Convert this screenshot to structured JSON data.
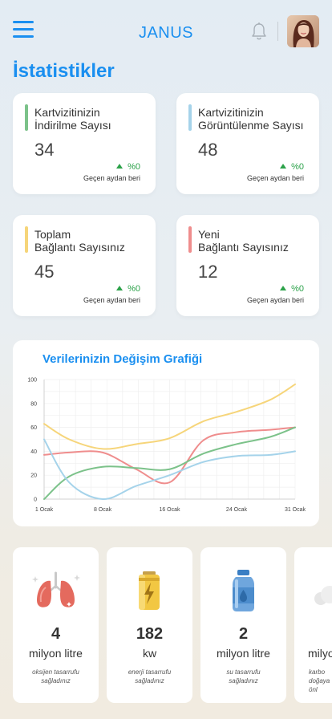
{
  "header": {
    "app_title": "JANUS",
    "menu_icon": "hamburger-menu-icon",
    "notification_icon": "bell-icon",
    "avatar": "user-avatar"
  },
  "page_title": "İstatistikler",
  "stats": [
    {
      "label": "Kartvizitinizin\nİndirilme Sayısı",
      "value": "34",
      "change": "%0",
      "since": "Geçen aydan beri",
      "accent": "#7cc28a"
    },
    {
      "label": "Kartvizitinizin\nGörüntülenme Sayısı",
      "value": "48",
      "change": "%0",
      "since": "Geçen aydan beri",
      "accent": "#a5d3ea"
    },
    {
      "label": "Toplam\nBağlantı Sayısınız",
      "value": "45",
      "change": "%0",
      "since": "Geçen aydan beri",
      "accent": "#f6d57a"
    },
    {
      "label": "Yeni\nBağlantı Sayısınız",
      "value": "12",
      "change": "%0",
      "since": "Geçen aydan beri",
      "accent": "#ef8d8d"
    }
  ],
  "chart": {
    "title": "Verilerinizin Değişim Grafiği"
  },
  "chart_data": {
    "type": "line",
    "title": "Verilerinizin Değişim Grafiği",
    "xlabel": "",
    "ylabel": "",
    "x_ticks": [
      "1 Ocak",
      "8 Ocak",
      "16 Ocak",
      "24 Ocak",
      "31 Ocak"
    ],
    "x_tick_values": [
      1,
      8,
      16,
      24,
      31
    ],
    "xlim": [
      1,
      31
    ],
    "ylim": [
      0,
      100
    ],
    "y_ticks": [
      0,
      20,
      40,
      60,
      80,
      100
    ],
    "grid": true,
    "series": [
      {
        "color": "#f6d57a",
        "x": [
          1,
          4,
          8,
          12,
          16,
          20,
          24,
          28,
          31
        ],
        "y": [
          63,
          50,
          42,
          46,
          51,
          65,
          73,
          83,
          96
        ]
      },
      {
        "color": "#ef8d8d",
        "x": [
          1,
          4,
          8,
          12,
          16,
          20,
          24,
          28,
          31
        ],
        "y": [
          37,
          39,
          39,
          25,
          14,
          49,
          56,
          58,
          60
        ]
      },
      {
        "color": "#7cc28a",
        "x": [
          1,
          4,
          8,
          12,
          16,
          20,
          24,
          28,
          31
        ],
        "y": [
          0,
          19,
          27,
          26,
          25,
          38,
          46,
          52,
          60
        ]
      },
      {
        "color": "#a5d3ea",
        "x": [
          1,
          4,
          8,
          12,
          16,
          20,
          24,
          28,
          31
        ],
        "y": [
          50,
          14,
          0,
          11,
          20,
          31,
          36,
          37,
          40
        ]
      }
    ]
  },
  "savings": [
    {
      "icon": "lungs-icon",
      "value": "4",
      "unit": "milyon litre",
      "desc": "oksijen tasarrufu\nsağladınız"
    },
    {
      "icon": "battery-icon",
      "value": "182",
      "unit": "kw",
      "desc": "enerji tasarrufu\nsağladınız"
    },
    {
      "icon": "water-bottle-icon",
      "value": "2",
      "unit": "milyon litre",
      "desc": "su tasarrufu\nsağladınız"
    },
    {
      "icon": "cloud-icon",
      "value": "",
      "unit": "milyo",
      "desc": "karbo\ndoğaya\nönl"
    }
  ]
}
